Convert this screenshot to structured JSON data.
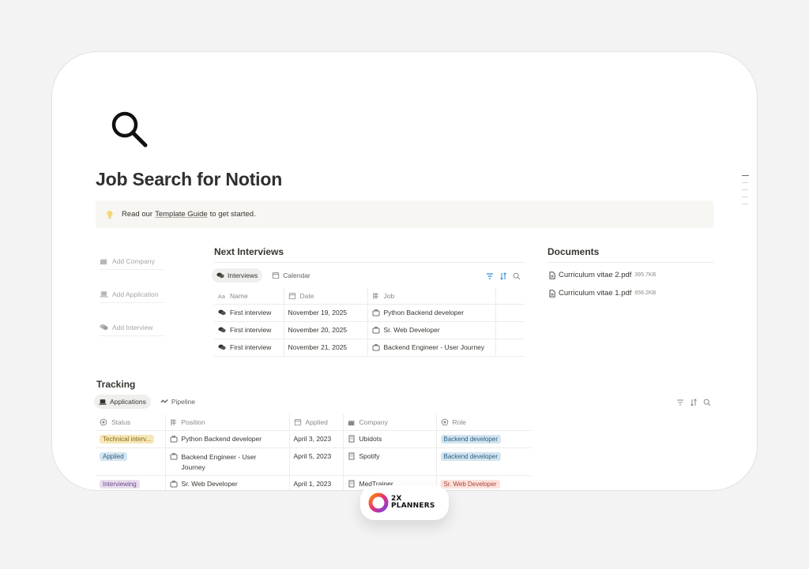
{
  "page": {
    "title": "Job Search for Notion",
    "icon": "magnifier-icon"
  },
  "callout": {
    "prefix": "Read our",
    "link": "Template Guide",
    "suffix": "to get started."
  },
  "quick_actions": [
    {
      "label": "Add Company",
      "icon": "company-icon"
    },
    {
      "label": "Add Application",
      "icon": "laptop-icon"
    },
    {
      "label": "Add Interview",
      "icon": "chat-icon"
    }
  ],
  "interviews": {
    "heading": "Next Interviews",
    "tabs": [
      {
        "label": "Interviews",
        "active": true
      },
      {
        "label": "Calendar",
        "active": false
      }
    ],
    "columns": [
      "Name",
      "Date",
      "Job"
    ],
    "rows": [
      {
        "name": "First interview",
        "date": "November 19, 2025",
        "job": "Python Backend developer"
      },
      {
        "name": "First interview",
        "date": "November 20, 2025",
        "job": "Sr. Web Developer"
      },
      {
        "name": "First interview",
        "date": "November 21, 2025",
        "job": "Backend Engineer - User Journey"
      }
    ]
  },
  "documents": {
    "heading": "Documents",
    "files": [
      {
        "name": "Curriculum vitae 2.pdf",
        "size": "395.7KB"
      },
      {
        "name": "Curriculum vitae 1.pdf",
        "size": "656.2KB"
      }
    ]
  },
  "tracking": {
    "heading": "Tracking",
    "tabs": [
      {
        "label": "Applications",
        "active": true
      },
      {
        "label": "Pipeline",
        "active": false
      }
    ],
    "columns": [
      "Status",
      "Position",
      "Applied",
      "Company",
      "Role"
    ],
    "rows": [
      {
        "status": "Technical interv...",
        "status_color": "#f6e7b6",
        "position": "Python Backend developer",
        "applied": "April 3, 2023",
        "company": "Ubidots",
        "role": "Backend developer",
        "role_color": "#d3e5ef"
      },
      {
        "status": "Applied",
        "status_color": "#d3e5ef",
        "position": "Backend Engineer - User Journey",
        "applied": "April 5, 2023",
        "company": "Spotify",
        "role": "Backend developer",
        "role_color": "#d3e5ef"
      },
      {
        "status": "Interviewing",
        "status_color": "#e8deee",
        "position": "Sr. Web Developer",
        "applied": "April 1, 2023",
        "company": "MedTrainer",
        "role": "Sr. Web Developer",
        "role_color": "#ffe2dd"
      }
    ]
  },
  "brand": {
    "line1": "2X",
    "line2": "PLANNERS"
  }
}
